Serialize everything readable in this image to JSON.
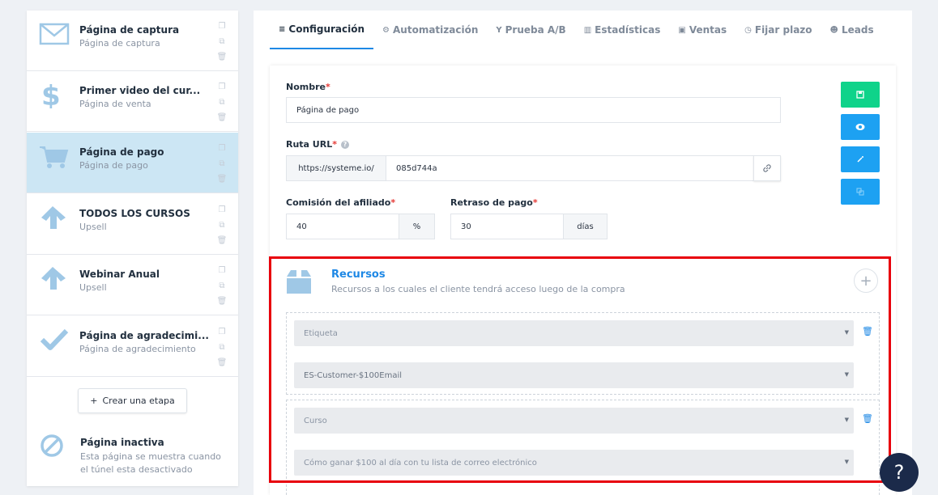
{
  "sidebar": {
    "steps": [
      {
        "title": "Página de captura",
        "subtitle": "Página de captura",
        "icon": "envelope-icon"
      },
      {
        "title": "Primer video del cur...",
        "subtitle": "Página de venta",
        "icon": "dollar-icon"
      },
      {
        "title": "Página de pago",
        "subtitle": "Página de pago",
        "icon": "cart-icon"
      },
      {
        "title": "TODOS LOS CURSOS",
        "subtitle": "Upsell",
        "icon": "arrow-up-icon"
      },
      {
        "title": "Webinar Anual",
        "subtitle": "Upsell",
        "icon": "arrow-up-icon"
      },
      {
        "title": "Página de agradecimi...",
        "subtitle": "Página de agradecimiento",
        "icon": "check-icon"
      }
    ],
    "create_button": "Crear una etapa",
    "create_button_icon": "+",
    "inactive": {
      "title": "Página inactiva",
      "description": "Esta página se muestra cuando el túnel esta desactivado"
    }
  },
  "tabs": [
    {
      "label": "Configuración",
      "icon": "≡",
      "active": true
    },
    {
      "label": "Automatización",
      "icon": "⚙",
      "active": false
    },
    {
      "label": "Prueba A/B",
      "icon": "Y",
      "active": false
    },
    {
      "label": "Estadísticas",
      "icon": "▥",
      "active": false
    },
    {
      "label": "Ventas",
      "icon": "▣",
      "active": false
    },
    {
      "label": "Fijar plazo",
      "icon": "◷",
      "active": false
    },
    {
      "label": "Leads",
      "icon": "☻",
      "active": false
    }
  ],
  "form": {
    "name_label": "Nombre",
    "name_value": "Página de pago",
    "url_label": "Ruta URL",
    "url_prefix": "https://systeme.io/",
    "url_value": "085d744a",
    "commission_label": "Comisión del afiliado",
    "commission_value": "40",
    "commission_unit": "%",
    "delay_label": "Retraso de pago",
    "delay_value": "30",
    "delay_unit": "días",
    "required_mark": "*"
  },
  "action_buttons": [
    {
      "name": "save",
      "color": "#0fd38a",
      "icon": "save-icon"
    },
    {
      "name": "preview",
      "color": "#1da1f2",
      "icon": "eye-icon"
    },
    {
      "name": "edit",
      "color": "#1da1f2",
      "icon": "magic-wand-icon"
    },
    {
      "name": "copy",
      "color": "#1da1f2",
      "icon": "copy-icon"
    }
  ],
  "resources": {
    "title": "Recursos",
    "subtitle": "Recursos a los cuales el cliente tendrá acceso luego de la compra",
    "groups": [
      {
        "type": "Etiqueta",
        "value": "ES-Customer-$100Email"
      },
      {
        "type": "Curso",
        "value": "Cómo ganar $100 al día con tu lista de correo electrónico"
      }
    ]
  },
  "help_fab": "?",
  "colors": {
    "accent": "#1e88e5",
    "highlight": "#e8000b",
    "active_step": "#cce6f4",
    "save": "#0fd38a"
  }
}
